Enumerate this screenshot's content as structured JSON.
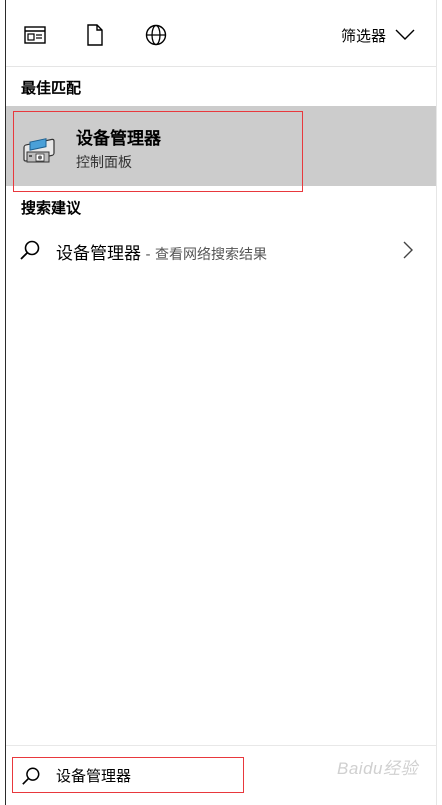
{
  "toolbar": {
    "icons": [
      "apps-icon",
      "document-icon",
      "web-icon"
    ],
    "filter_label": "筛选器"
  },
  "best_match": {
    "heading": "最佳匹配",
    "title": "设备管理器",
    "subtitle": "控制面板"
  },
  "suggestions": {
    "heading": "搜索建议",
    "items": [
      {
        "text": "设备管理器",
        "sub": " - 查看网络搜索结果"
      }
    ]
  },
  "search": {
    "query": "设备管理器"
  },
  "watermark": "Baidu经验",
  "colors": {
    "highlight": "#cccccc",
    "annotation_red": "#e8383d"
  }
}
